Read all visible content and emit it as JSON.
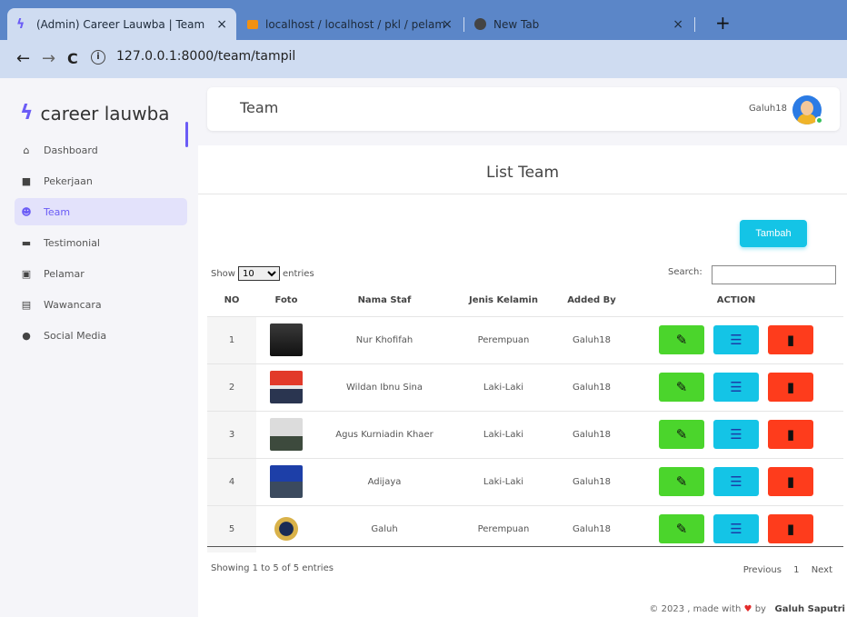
{
  "browser": {
    "tabs": [
      {
        "title": "(Admin) Career Lauwba | Team",
        "close": "×"
      },
      {
        "title": "localhost / localhost / pkl / pelam",
        "close": "×"
      },
      {
        "title": "New Tab",
        "close": "×"
      }
    ],
    "new_tab": "+",
    "url": "127.0.0.1:8000/team/tampil"
  },
  "sidebar": {
    "brand": "career lauwba",
    "items": [
      {
        "label": "Dashboard"
      },
      {
        "label": "Pekerjaan"
      },
      {
        "label": "Team"
      },
      {
        "label": "Testimonial"
      },
      {
        "label": "Pelamar"
      },
      {
        "label": "Wawancara"
      },
      {
        "label": "Social Media"
      }
    ]
  },
  "navbar": {
    "title": "Team",
    "user": "Galuh18"
  },
  "card": {
    "title": "List Team",
    "add_button": "Tambah",
    "show_label": "Show",
    "entries_value": "10",
    "entries_label": "entries",
    "search_label": "Search:"
  },
  "table": {
    "headers": [
      "NO",
      "Foto",
      "Nama Staf",
      "Jenis Kelamin",
      "Added By",
      "ACTION"
    ],
    "rows": [
      {
        "no": "1",
        "nama": "Nur Khofifah",
        "jk": "Perempuan",
        "by": "Galuh18"
      },
      {
        "no": "2",
        "nama": "Wildan Ibnu Sina",
        "jk": "Laki-Laki",
        "by": "Galuh18"
      },
      {
        "no": "3",
        "nama": "Agus Kurniadin Khaer",
        "jk": "Laki-Laki",
        "by": "Galuh18"
      },
      {
        "no": "4",
        "nama": "Adijaya",
        "jk": "Laki-Laki",
        "by": "Galuh18"
      },
      {
        "no": "5",
        "nama": "Galuh",
        "jk": "Perempuan",
        "by": "Galuh18"
      }
    ]
  },
  "pagination": {
    "info": "Showing 1 to 5 of 5 entries",
    "previous": "Previous",
    "page": "1",
    "next": "Next"
  },
  "footer": {
    "prefix": "© 2023 , made with",
    "by": "by",
    "author": "Galuh Saputri"
  }
}
